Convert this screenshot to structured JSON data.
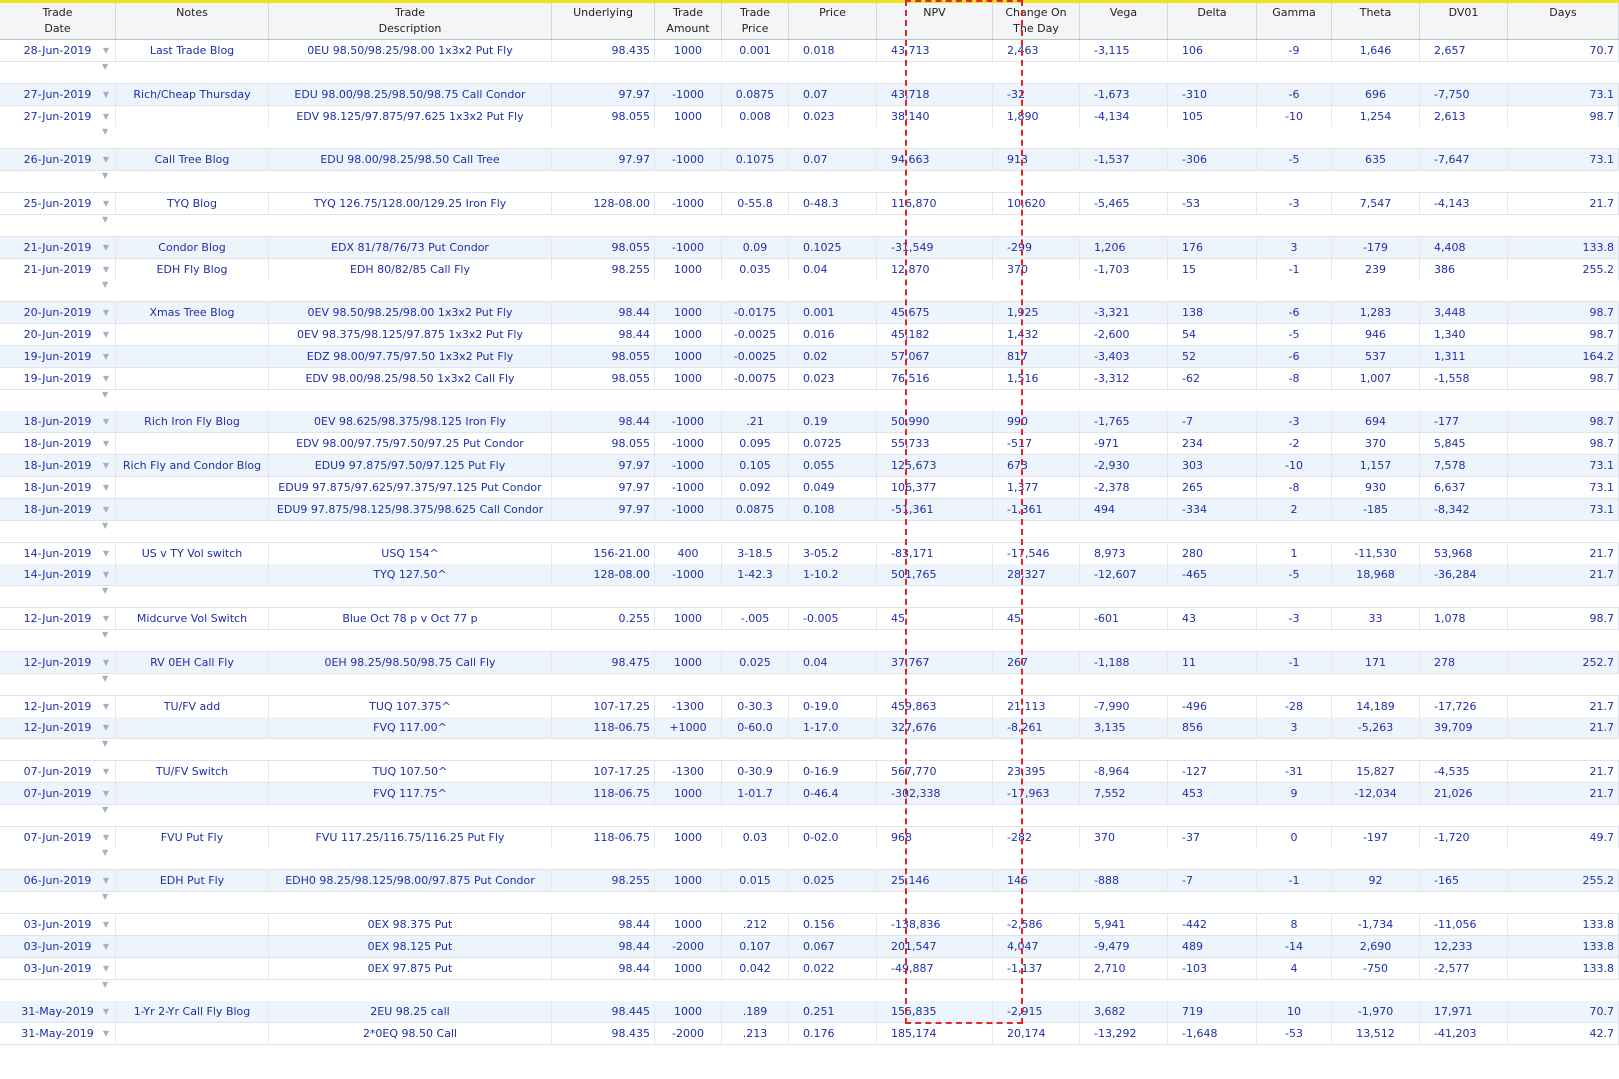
{
  "columns": [
    {
      "key": "date",
      "label": "Trade\nDate"
    },
    {
      "key": "notes",
      "label": "Notes"
    },
    {
      "key": "desc",
      "label": "Trade\nDescription"
    },
    {
      "key": "underlying",
      "label": "Underlying"
    },
    {
      "key": "amount",
      "label": "Trade\nAmount"
    },
    {
      "key": "tprice",
      "label": "Trade\nPrice"
    },
    {
      "key": "price",
      "label": "Price"
    },
    {
      "key": "npv",
      "label": "NPV"
    },
    {
      "key": "change",
      "label": "Change On\nThe Day"
    },
    {
      "key": "vega",
      "label": "Vega"
    },
    {
      "key": "delta",
      "label": "Delta"
    },
    {
      "key": "gamma",
      "label": "Gamma"
    },
    {
      "key": "theta",
      "label": "Theta"
    },
    {
      "key": "dv01",
      "label": "DV01"
    },
    {
      "key": "days",
      "label": "Days"
    }
  ],
  "dropdown_icon": "▼",
  "rows": [
    [
      "28-Jun-2019",
      "Last Trade Blog",
      "0EU 98.50/98.25/98.00 1x3x2 Put Fly",
      "98.435",
      "1000",
      "0.001",
      "0.018",
      "43,713",
      "2,463",
      "-3,115",
      "106",
      "-9",
      "1,646",
      "2,657",
      "70.7"
    ],
    null,
    [
      "27-Jun-2019",
      "Rich/Cheap Thursday",
      "EDU 98.00/98.25/98.50/98.75 Call Condor",
      "97.97",
      "-1000",
      "0.0875",
      "0.07",
      "43,718",
      "-32",
      "-1,673",
      "-310",
      "-6",
      "696",
      "-7,750",
      "73.1"
    ],
    [
      "27-Jun-2019",
      "",
      "EDV 98.125/97.875/97.625 1x3x2 Put Fly",
      "98.055",
      "1000",
      "0.008",
      "0.023",
      "38,140",
      "1,890",
      "-4,134",
      "105",
      "-10",
      "1,254",
      "2,613",
      "98.7"
    ],
    null,
    [
      "26-Jun-2019",
      "Call Tree Blog",
      "EDU 98.00/98.25/98.50 Call Tree",
      "97.97",
      "-1000",
      "0.1075",
      "0.07",
      "94,663",
      "913",
      "-1,537",
      "-306",
      "-5",
      "635",
      "-7,647",
      "73.1"
    ],
    null,
    [
      "25-Jun-2019",
      "TYQ Blog",
      "TYQ 126.75/128.00/129.25 Iron Fly",
      "128-08.00",
      "-1000",
      "0-55.8",
      "0-48.3",
      "116,870",
      "10,620",
      "-5,465",
      "-53",
      "-3",
      "7,547",
      "-4,143",
      "21.7"
    ],
    null,
    [
      "21-Jun-2019",
      "Condor Blog",
      "EDX 81/78/76/73 Put Condor",
      "98.055",
      "-1000",
      "0.09",
      "0.1025",
      "-31,549",
      "-299",
      "1,206",
      "176",
      "3",
      "-179",
      "4,408",
      "133.8"
    ],
    [
      "21-Jun-2019",
      "EDH Fly Blog",
      "EDH 80/82/85 Call Fly",
      "98.255",
      "1000",
      "0.035",
      "0.04",
      "12,870",
      "370",
      "-1,703",
      "15",
      "-1",
      "239",
      "386",
      "255.2"
    ],
    null,
    [
      "20-Jun-2019",
      "Xmas Tree Blog",
      "0EV 98.50/98.25/98.00 1x3x2 Put Fly",
      "98.44",
      "1000",
      "-0.0175",
      "0.001",
      "45,675",
      "1,925",
      "-3,321",
      "138",
      "-6",
      "1,283",
      "3,448",
      "98.7"
    ],
    [
      "20-Jun-2019",
      "",
      "0EV 98.375/98.125/97.875 1x3x2 Put Fly",
      "98.44",
      "1000",
      "-0.0025",
      "0.016",
      "45,182",
      "1,432",
      "-2,600",
      "54",
      "-5",
      "946",
      "1,340",
      "98.7"
    ],
    [
      "19-Jun-2019",
      "",
      "EDZ 98.00/97.75/97.50 1x3x2 Put Fly",
      "98.055",
      "1000",
      "-0.0025",
      "0.02",
      "57,067",
      "817",
      "-3,403",
      "52",
      "-6",
      "537",
      "1,311",
      "164.2"
    ],
    [
      "19-Jun-2019",
      "",
      "EDV 98.00/98.25/98.50 1x3x2 Call Fly",
      "98.055",
      "1000",
      "-0.0075",
      "0.023",
      "76,516",
      "1,516",
      "-3,312",
      "-62",
      "-8",
      "1,007",
      "-1,558",
      "98.7"
    ],
    null,
    [
      "18-Jun-2019",
      "Rich Iron Fly Blog",
      "0EV 98.625/98.375/98.125 Iron Fly",
      "98.44",
      "-1000",
      ".21",
      "0.19",
      "50,990",
      "990",
      "-1,765",
      "-7",
      "-3",
      "694",
      "-177",
      "98.7"
    ],
    [
      "18-Jun-2019",
      "",
      "EDV 98.00/97.75/97.50/97.25 Put Condor",
      "98.055",
      "-1000",
      "0.095",
      "0.0725",
      "55,733",
      "-517",
      "-971",
      "234",
      "-2",
      "370",
      "5,845",
      "98.7"
    ],
    [
      "18-Jun-2019",
      "Rich Fly and Condor Blog",
      "EDU9 97.875/97.50/97.125 Put Fly",
      "97.97",
      "-1000",
      "0.105",
      "0.055",
      "125,673",
      "673",
      "-2,930",
      "303",
      "-10",
      "1,157",
      "7,578",
      "73.1"
    ],
    [
      "18-Jun-2019",
      "",
      "EDU9 97.875/97.625/97.375/97.125 Put Condor",
      "97.97",
      "-1000",
      "0.092",
      "0.049",
      "106,377",
      "1,377",
      "-2,378",
      "265",
      "-8",
      "930",
      "6,637",
      "73.1"
    ],
    [
      "18-Jun-2019",
      "",
      "EDU9 97.875/98.125/98.375/98.625 Call Condor",
      "97.97",
      "-1000",
      "0.0875",
      "0.108",
      "-51,361",
      "-1,361",
      "494",
      "-334",
      "2",
      "-185",
      "-8,342",
      "73.1"
    ],
    null,
    [
      "14-Jun-2019",
      "US v TY Vol switch",
      "USQ 154^",
      "156-21.00",
      "400",
      "3-18.5",
      "3-05.2",
      "-83,171",
      "-17,546",
      "8,973",
      "280",
      "1",
      "-11,530",
      "53,968",
      "21.7"
    ],
    [
      "14-Jun-2019",
      "",
      "TYQ 127.50^",
      "128-08.00",
      "-1000",
      "1-42.3",
      "1-10.2",
      "501,765",
      "28,327",
      "-12,607",
      "-465",
      "-5",
      "18,968",
      "-36,284",
      "21.7"
    ],
    null,
    [
      "12-Jun-2019",
      "Midcurve Vol Switch",
      "Blue Oct 78 p v Oct 77 p",
      "0.255",
      "1000",
      "-.005",
      "-0.005",
      "45",
      "45",
      "-601",
      "43",
      "-3",
      "33",
      "1,078",
      "98.7"
    ],
    null,
    [
      "12-Jun-2019",
      "RV 0EH Call Fly",
      "0EH 98.25/98.50/98.75 Call Fly",
      "98.475",
      "1000",
      "0.025",
      "0.04",
      "37,767",
      "267",
      "-1,188",
      "11",
      "-1",
      "171",
      "278",
      "252.7"
    ],
    null,
    [
      "12-Jun-2019",
      "TU/FV add",
      "TUQ 107.375^",
      "107-17.25",
      "-1300",
      "0-30.3",
      "0-19.0",
      "459,863",
      "21,113",
      "-7,990",
      "-496",
      "-28",
      "14,189",
      "-17,726",
      "21.7"
    ],
    [
      "12-Jun-2019",
      "",
      "FVQ 117.00^",
      "118-06.75",
      "+1000",
      "0-60.0",
      "1-17.0",
      "327,676",
      "-8,261",
      "3,135",
      "856",
      "3",
      "-5,263",
      "39,709",
      "21.7"
    ],
    null,
    [
      "07-Jun-2019",
      "TU/FV Switch",
      "TUQ 107.50^",
      "107-17.25",
      "-1300",
      "0-30.9",
      "0-16.9",
      "567,770",
      "23,395",
      "-8,964",
      "-127",
      "-31",
      "15,827",
      "-4,535",
      "21.7"
    ],
    [
      "07-Jun-2019",
      "",
      "FVQ 117.75^",
      "118-06.75",
      "1000",
      "1-01.7",
      "0-46.4",
      "-302,338",
      "-17,963",
      "7,552",
      "453",
      "9",
      "-12,034",
      "21,026",
      "21.7"
    ],
    null,
    [
      "07-Jun-2019",
      "FVU Put Fly",
      "FVU 117.25/116.75/116.25 Put Fly",
      "118-06.75",
      "1000",
      "0.03",
      "0-02.0",
      "968",
      "-282",
      "370",
      "-37",
      "0",
      "-197",
      "-1,720",
      "49.7"
    ],
    null,
    [
      "06-Jun-2019",
      "EDH Put Fly",
      "EDH0 98.25/98.125/98.00/97.875 Put Condor",
      "98.255",
      "1000",
      "0.015",
      "0.025",
      "25,146",
      "146",
      "-888",
      "-7",
      "-1",
      "92",
      "-165",
      "255.2"
    ],
    null,
    [
      "03-Jun-2019",
      "",
      "0EX 98.375 Put",
      "98.44",
      "1000",
      ".212",
      "0.156",
      "-138,836",
      "-2,586",
      "5,941",
      "-442",
      "8",
      "-1,734",
      "-11,056",
      "133.8"
    ],
    [
      "03-Jun-2019",
      "",
      "0EX 98.125 Put",
      "98.44",
      "-2000",
      "0.107",
      "0.067",
      "201,547",
      "4,047",
      "-9,479",
      "489",
      "-14",
      "2,690",
      "12,233",
      "133.8"
    ],
    [
      "03-Jun-2019",
      "",
      "0EX 97.875 Put",
      "98.44",
      "1000",
      "0.042",
      "0.022",
      "-49,887",
      "-1,137",
      "2,710",
      "-103",
      "4",
      "-750",
      "-2,577",
      "133.8"
    ],
    null,
    [
      "31-May-2019",
      "1-Yr 2-Yr Call Fly Blog",
      "2EU 98.25 call",
      "98.445",
      "1000",
      ".189",
      "0.251",
      "155,835",
      "-2,915",
      "3,682",
      "719",
      "10",
      "-1,970",
      "17,971",
      "70.7"
    ],
    [
      "31-May-2019",
      "",
      "2*0EQ 98.50 Call",
      "98.435",
      "-2000",
      ".213",
      "0.176",
      "185,174",
      "20,174",
      "-13,292",
      "-1,648",
      "-53",
      "13,512",
      "-41,203",
      "42.7"
    ]
  ]
}
